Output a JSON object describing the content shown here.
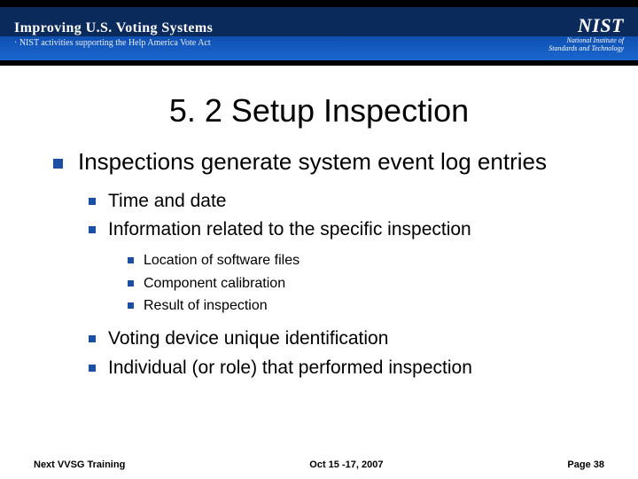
{
  "banner": {
    "title": "Improving U.S. Voting Systems",
    "subtitle": "· NIST activities supporting the Help America Vote Act",
    "logo": "NIST",
    "logo_sub1": "National Institute of",
    "logo_sub2": "Standards and Technology"
  },
  "slide": {
    "title": "5. 2 Setup Inspection"
  },
  "bullets": {
    "l1_0": "Inspections generate system event log entries",
    "l2_0": "Time and date",
    "l2_1": "Information related to the specific inspection",
    "l3_0": "Location of software files",
    "l3_1": "Component calibration",
    "l3_2": "Result of inspection",
    "l2_2": "Voting device unique identification",
    "l2_3": "Individual (or role) that performed inspection"
  },
  "footer": {
    "left": "Next VVSG Training",
    "center": "Oct 15 -17, 2007",
    "right": "Page 38"
  }
}
